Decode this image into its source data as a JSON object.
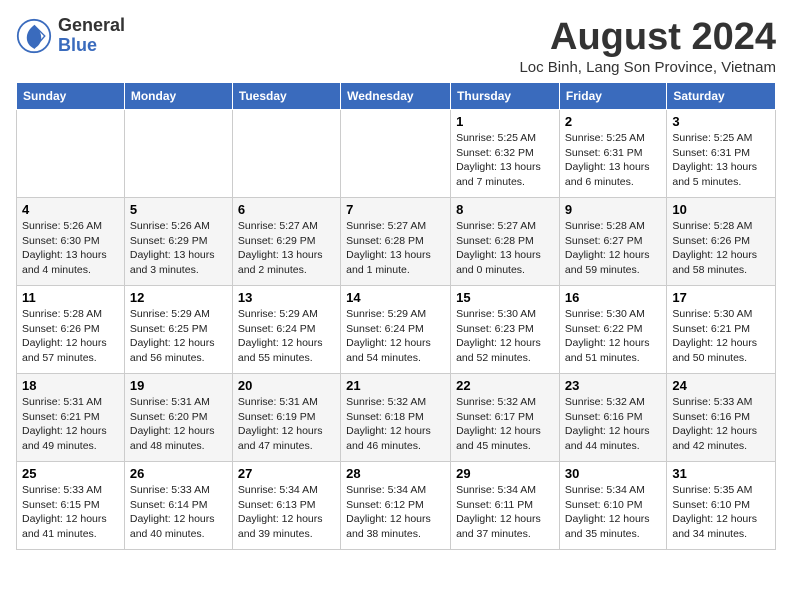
{
  "logo": {
    "general": "General",
    "blue": "Blue"
  },
  "title": "August 2024",
  "subtitle": "Loc Binh, Lang Son Province, Vietnam",
  "weekdays": [
    "Sunday",
    "Monday",
    "Tuesday",
    "Wednesday",
    "Thursday",
    "Friday",
    "Saturday"
  ],
  "weeks": [
    [
      {
        "day": "",
        "info": ""
      },
      {
        "day": "",
        "info": ""
      },
      {
        "day": "",
        "info": ""
      },
      {
        "day": "",
        "info": ""
      },
      {
        "day": "1",
        "info": "Sunrise: 5:25 AM\nSunset: 6:32 PM\nDaylight: 13 hours and 7 minutes."
      },
      {
        "day": "2",
        "info": "Sunrise: 5:25 AM\nSunset: 6:31 PM\nDaylight: 13 hours and 6 minutes."
      },
      {
        "day": "3",
        "info": "Sunrise: 5:25 AM\nSunset: 6:31 PM\nDaylight: 13 hours and 5 minutes."
      }
    ],
    [
      {
        "day": "4",
        "info": "Sunrise: 5:26 AM\nSunset: 6:30 PM\nDaylight: 13 hours and 4 minutes."
      },
      {
        "day": "5",
        "info": "Sunrise: 5:26 AM\nSunset: 6:29 PM\nDaylight: 13 hours and 3 minutes."
      },
      {
        "day": "6",
        "info": "Sunrise: 5:27 AM\nSunset: 6:29 PM\nDaylight: 13 hours and 2 minutes."
      },
      {
        "day": "7",
        "info": "Sunrise: 5:27 AM\nSunset: 6:28 PM\nDaylight: 13 hours and 1 minute."
      },
      {
        "day": "8",
        "info": "Sunrise: 5:27 AM\nSunset: 6:28 PM\nDaylight: 13 hours and 0 minutes."
      },
      {
        "day": "9",
        "info": "Sunrise: 5:28 AM\nSunset: 6:27 PM\nDaylight: 12 hours and 59 minutes."
      },
      {
        "day": "10",
        "info": "Sunrise: 5:28 AM\nSunset: 6:26 PM\nDaylight: 12 hours and 58 minutes."
      }
    ],
    [
      {
        "day": "11",
        "info": "Sunrise: 5:28 AM\nSunset: 6:26 PM\nDaylight: 12 hours and 57 minutes."
      },
      {
        "day": "12",
        "info": "Sunrise: 5:29 AM\nSunset: 6:25 PM\nDaylight: 12 hours and 56 minutes."
      },
      {
        "day": "13",
        "info": "Sunrise: 5:29 AM\nSunset: 6:24 PM\nDaylight: 12 hours and 55 minutes."
      },
      {
        "day": "14",
        "info": "Sunrise: 5:29 AM\nSunset: 6:24 PM\nDaylight: 12 hours and 54 minutes."
      },
      {
        "day": "15",
        "info": "Sunrise: 5:30 AM\nSunset: 6:23 PM\nDaylight: 12 hours and 52 minutes."
      },
      {
        "day": "16",
        "info": "Sunrise: 5:30 AM\nSunset: 6:22 PM\nDaylight: 12 hours and 51 minutes."
      },
      {
        "day": "17",
        "info": "Sunrise: 5:30 AM\nSunset: 6:21 PM\nDaylight: 12 hours and 50 minutes."
      }
    ],
    [
      {
        "day": "18",
        "info": "Sunrise: 5:31 AM\nSunset: 6:21 PM\nDaylight: 12 hours and 49 minutes."
      },
      {
        "day": "19",
        "info": "Sunrise: 5:31 AM\nSunset: 6:20 PM\nDaylight: 12 hours and 48 minutes."
      },
      {
        "day": "20",
        "info": "Sunrise: 5:31 AM\nSunset: 6:19 PM\nDaylight: 12 hours and 47 minutes."
      },
      {
        "day": "21",
        "info": "Sunrise: 5:32 AM\nSunset: 6:18 PM\nDaylight: 12 hours and 46 minutes."
      },
      {
        "day": "22",
        "info": "Sunrise: 5:32 AM\nSunset: 6:17 PM\nDaylight: 12 hours and 45 minutes."
      },
      {
        "day": "23",
        "info": "Sunrise: 5:32 AM\nSunset: 6:16 PM\nDaylight: 12 hours and 44 minutes."
      },
      {
        "day": "24",
        "info": "Sunrise: 5:33 AM\nSunset: 6:16 PM\nDaylight: 12 hours and 42 minutes."
      }
    ],
    [
      {
        "day": "25",
        "info": "Sunrise: 5:33 AM\nSunset: 6:15 PM\nDaylight: 12 hours and 41 minutes."
      },
      {
        "day": "26",
        "info": "Sunrise: 5:33 AM\nSunset: 6:14 PM\nDaylight: 12 hours and 40 minutes."
      },
      {
        "day": "27",
        "info": "Sunrise: 5:34 AM\nSunset: 6:13 PM\nDaylight: 12 hours and 39 minutes."
      },
      {
        "day": "28",
        "info": "Sunrise: 5:34 AM\nSunset: 6:12 PM\nDaylight: 12 hours and 38 minutes."
      },
      {
        "day": "29",
        "info": "Sunrise: 5:34 AM\nSunset: 6:11 PM\nDaylight: 12 hours and 37 minutes."
      },
      {
        "day": "30",
        "info": "Sunrise: 5:34 AM\nSunset: 6:10 PM\nDaylight: 12 hours and 35 minutes."
      },
      {
        "day": "31",
        "info": "Sunrise: 5:35 AM\nSunset: 6:10 PM\nDaylight: 12 hours and 34 minutes."
      }
    ]
  ]
}
